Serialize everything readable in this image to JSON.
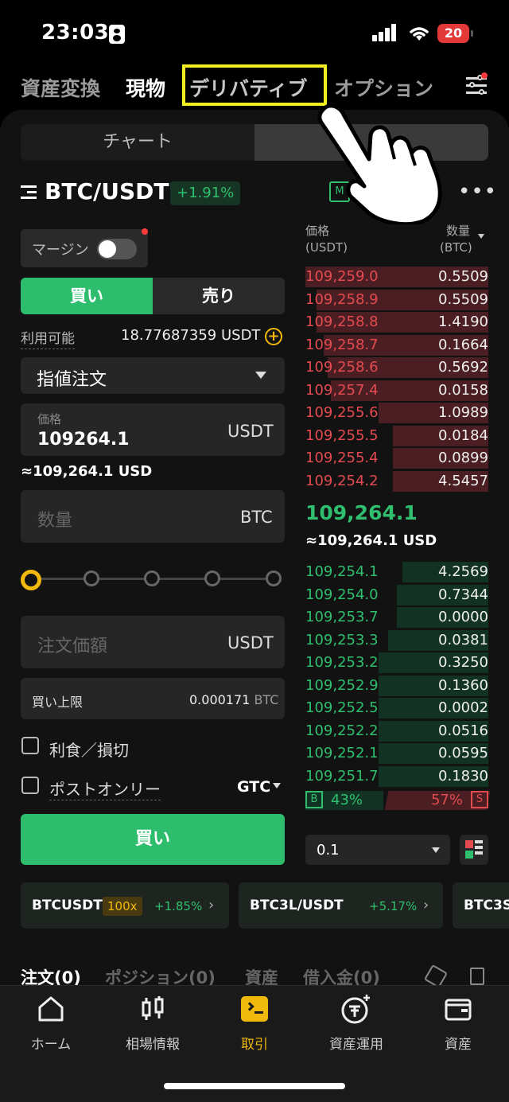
{
  "status": {
    "time": "23:03",
    "battery": "20"
  },
  "top_tabs": [
    "資産変換",
    "現物",
    "デリバティブ",
    "オプション"
  ],
  "segment": {
    "chart": "チャート"
  },
  "pair": {
    "symbol": "BTC/USDT",
    "change": "+1.91%",
    "m_label": "M"
  },
  "form": {
    "margin_label": "マージン",
    "buy": "買い",
    "sell": "売り",
    "available_label": "利用可能",
    "available_value": "18.77687359 USDT",
    "order_type": "指値注文",
    "price_label": "価格",
    "price_value": "109264.1",
    "price_unit": "USDT",
    "price_approx": "≈109,264.1 USD",
    "qty_placeholder": "数量",
    "qty_unit": "BTC",
    "amount_placeholder": "注文価額",
    "amount_unit": "USDT",
    "limit_label": "買い上限",
    "limit_value": "0.000171",
    "limit_unit": "BTC",
    "tpsl": "利食／損切",
    "post_only": "ポストオンリー",
    "tif": "GTC",
    "submit": "買い"
  },
  "orderbook": {
    "price_header": "価格",
    "price_unit": "(USDT)",
    "qty_header": "数量",
    "qty_unit": "(BTC)",
    "asks": [
      {
        "p": "109,259.0",
        "q": "0.5509",
        "d": 1.0
      },
      {
        "p": "109,258.9",
        "q": "0.5509",
        "d": 0.94
      },
      {
        "p": "109,258.8",
        "q": "1.4190",
        "d": 0.94
      },
      {
        "p": "109,258.7",
        "q": "0.1664",
        "d": 0.9
      },
      {
        "p": "109,258.6",
        "q": "0.5692",
        "d": 0.88
      },
      {
        "p": "109,257.4",
        "q": "0.0158",
        "d": 0.86
      },
      {
        "p": "109,255.6",
        "q": "1.0989",
        "d": 0.6
      },
      {
        "p": "109,255.5",
        "q": "0.0184",
        "d": 0.52
      },
      {
        "p": "109,255.4",
        "q": "0.0899",
        "d": 0.52
      },
      {
        "p": "109,254.2",
        "q": "4.5457",
        "d": 0.52
      }
    ],
    "last_price": "109,264.1",
    "last_usd": "≈109,264.1 USD",
    "bids": [
      {
        "p": "109,254.1",
        "q": "4.2569",
        "d": 0.47
      },
      {
        "p": "109,254.0",
        "q": "0.7344",
        "d": 0.5
      },
      {
        "p": "109,253.7",
        "q": "0.0000",
        "d": 0.5
      },
      {
        "p": "109,253.3",
        "q": "0.0381",
        "d": 0.55
      },
      {
        "p": "109,253.2",
        "q": "0.3250",
        "d": 0.6
      },
      {
        "p": "109,252.9",
        "q": "0.1360",
        "d": 0.6
      },
      {
        "p": "109,252.5",
        "q": "0.0002",
        "d": 0.6
      },
      {
        "p": "109,252.2",
        "q": "0.0516",
        "d": 0.6
      },
      {
        "p": "109,252.1",
        "q": "0.0595",
        "d": 0.6
      },
      {
        "p": "109,251.7",
        "q": "0.1830",
        "d": 0.6
      }
    ],
    "buy_ratio": "43%",
    "sell_ratio": "57%",
    "b": "B",
    "s": "S",
    "depth": "0.1"
  },
  "cards": [
    {
      "name": "BTCUSDT",
      "lev": "100x",
      "chg": "+1.85%"
    },
    {
      "name": "BTC3L/USDT",
      "chg": "+5.17%"
    },
    {
      "name": "BTC3S"
    }
  ],
  "bottom_tabs": [
    "注文(0)",
    "ポジション(0)",
    "資産",
    "借入金(0)"
  ],
  "nav": [
    "ホーム",
    "相場情報",
    "取引",
    "資産運用",
    "資産"
  ],
  "colors": {
    "buy": "#2ebd6c",
    "sell": "#e34b50",
    "accent": "#f0b90b",
    "highlight": "#f3ee20"
  }
}
